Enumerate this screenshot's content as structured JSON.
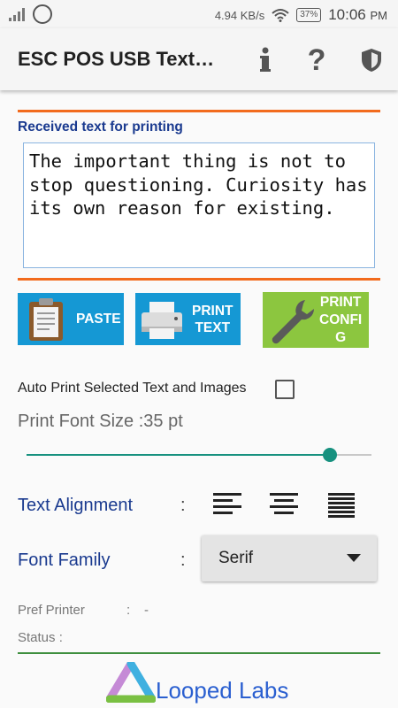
{
  "statusbar": {
    "network_speed": "4.94 KB/s",
    "battery": "37%",
    "time": "10:06",
    "ampm": "PM",
    "icons": [
      "signal-icon",
      "whatsapp-icon",
      "wifi-icon",
      "battery-icon"
    ]
  },
  "appbar": {
    "title": "ESC POS USB Text…",
    "icons": [
      "info-icon",
      "help-icon",
      "shield-icon"
    ]
  },
  "received": {
    "label": "Received text for printing",
    "text": "The important thing is not to stop questioning. Curiosity has its own reason for existing."
  },
  "buttons": {
    "paste": "PASTE",
    "print_text_1": "PRINT",
    "print_text_2": "TEXT",
    "print_config_1": "PRINT",
    "print_config_2": "CONFI",
    "print_config_3": "G"
  },
  "auto_print": {
    "label": "Auto Print Selected Text and Images",
    "checked": false
  },
  "font_size": {
    "label": "Print Font Size :35 pt",
    "slider_fraction": 0.88
  },
  "text_alignment": {
    "label": "Text Alignment",
    "colon": ":",
    "options": [
      "align-left-icon",
      "align-center-icon",
      "align-justify-icon"
    ]
  },
  "font_family": {
    "label": "Font Family",
    "colon": ":",
    "selected": "Serif"
  },
  "info": {
    "pref_printer_label": "Pref Printer",
    "pref_printer_colon": ":",
    "pref_printer_value": "-",
    "status_label": "Status :"
  },
  "brand": {
    "name": "Looped Labs"
  },
  "colors": {
    "accent_orange": "#f26b1d",
    "label_blue": "#1a3a8f",
    "button_blue": "#1598d4",
    "button_green": "#8cc63f",
    "slider_teal": "#17917f",
    "brand_blue": "#2a5fd0"
  }
}
